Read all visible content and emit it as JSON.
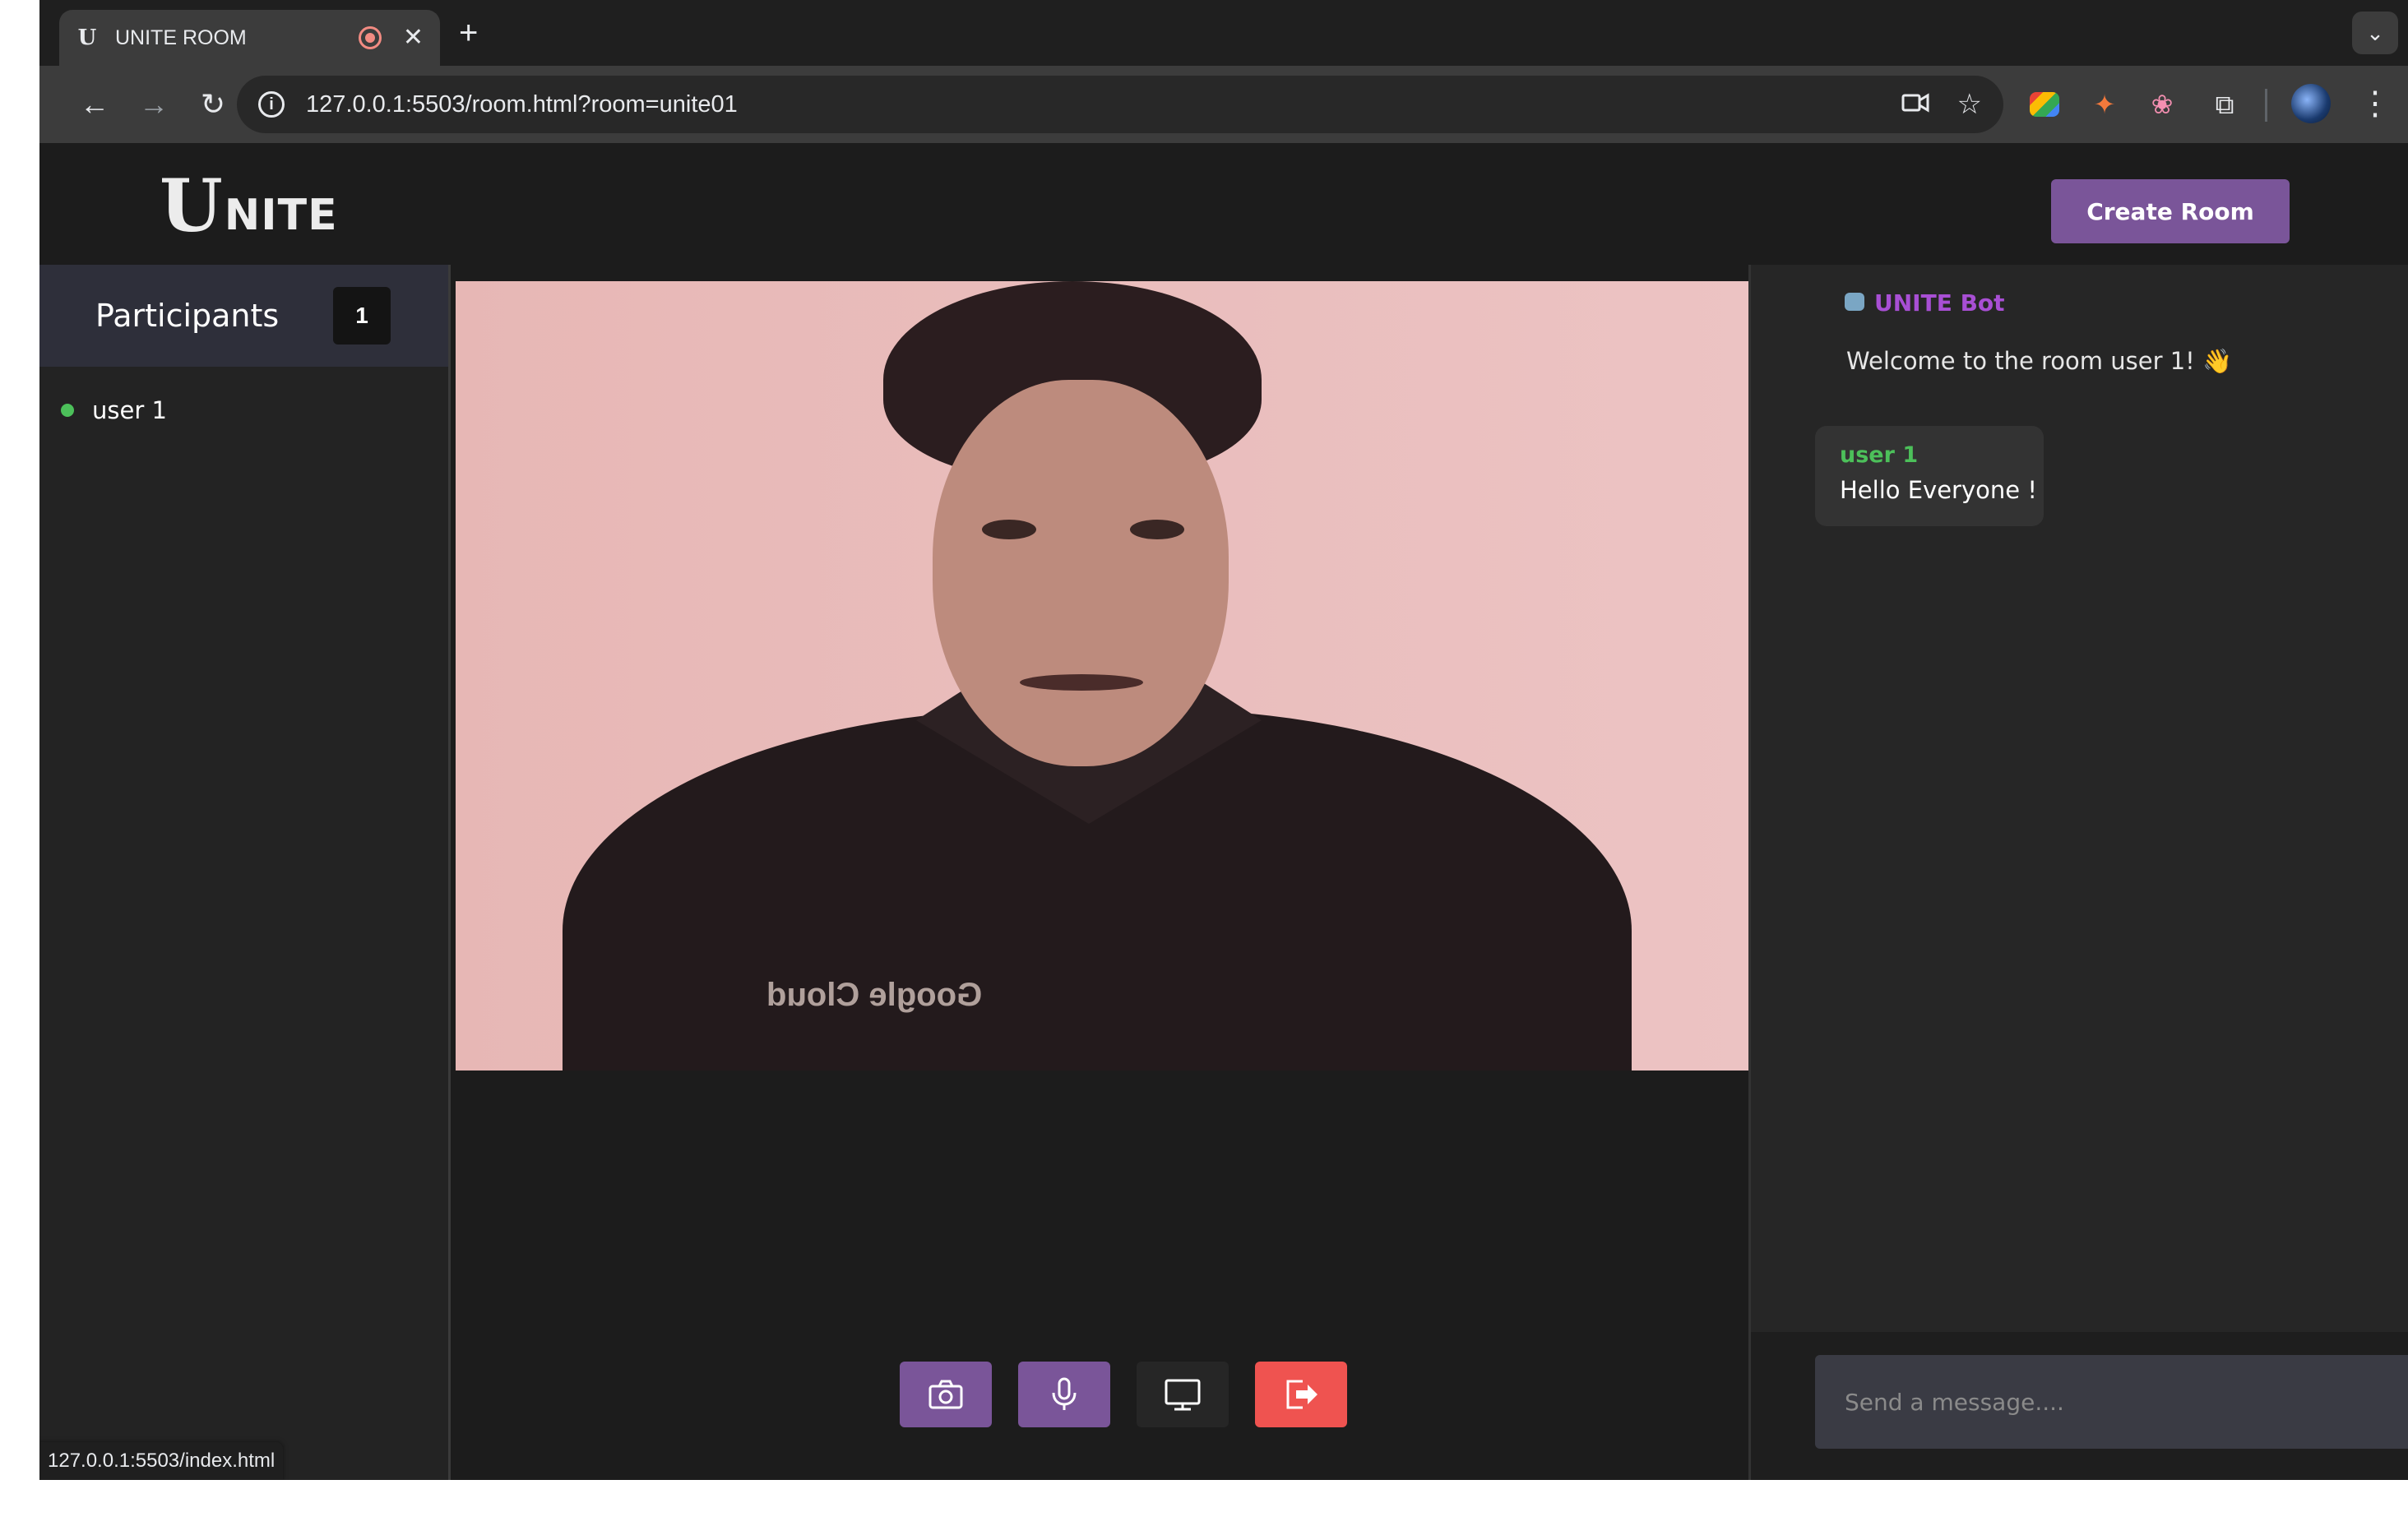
{
  "browser": {
    "tab_title": "UNITE ROOM",
    "tab_favicon": "U",
    "url": "127.0.0.1:5503/room.html?room=unite01",
    "status_url": "127.0.0.1:5503/index.html",
    "icons": [
      "back-arrow-icon",
      "forward-arrow-icon",
      "reload-icon",
      "info-icon",
      "camera-icon",
      "star-icon",
      "extension-icon",
      "kebab-menu-icon"
    ]
  },
  "header": {
    "logo_u": "U",
    "logo_rest": "NITE",
    "create_room_label": "Create Room"
  },
  "sidebar": {
    "title": "Participants",
    "count": "1",
    "participants": [
      {
        "name": "user 1",
        "status": "online"
      }
    ]
  },
  "video": {
    "shirt_text": "Google Cloud"
  },
  "controls": [
    {
      "name": "camera",
      "color": "#7a5599"
    },
    {
      "name": "microphone",
      "color": "#7a5599"
    },
    {
      "name": "screen-share",
      "color": "#262626"
    },
    {
      "name": "leave",
      "color": "#ef5350"
    }
  ],
  "chat": {
    "bot_name": "UNITE Bot",
    "bot_message": "Welcome to the room user 1! 👋",
    "messages": [
      {
        "user": "user 1",
        "text": "Hello Everyone !"
      }
    ],
    "input_placeholder": "Send a message...."
  },
  "colors": {
    "accent": "#7a5599",
    "bot_name": "#a84fd4",
    "online": "#4cc05a",
    "leave": "#ef5350"
  }
}
